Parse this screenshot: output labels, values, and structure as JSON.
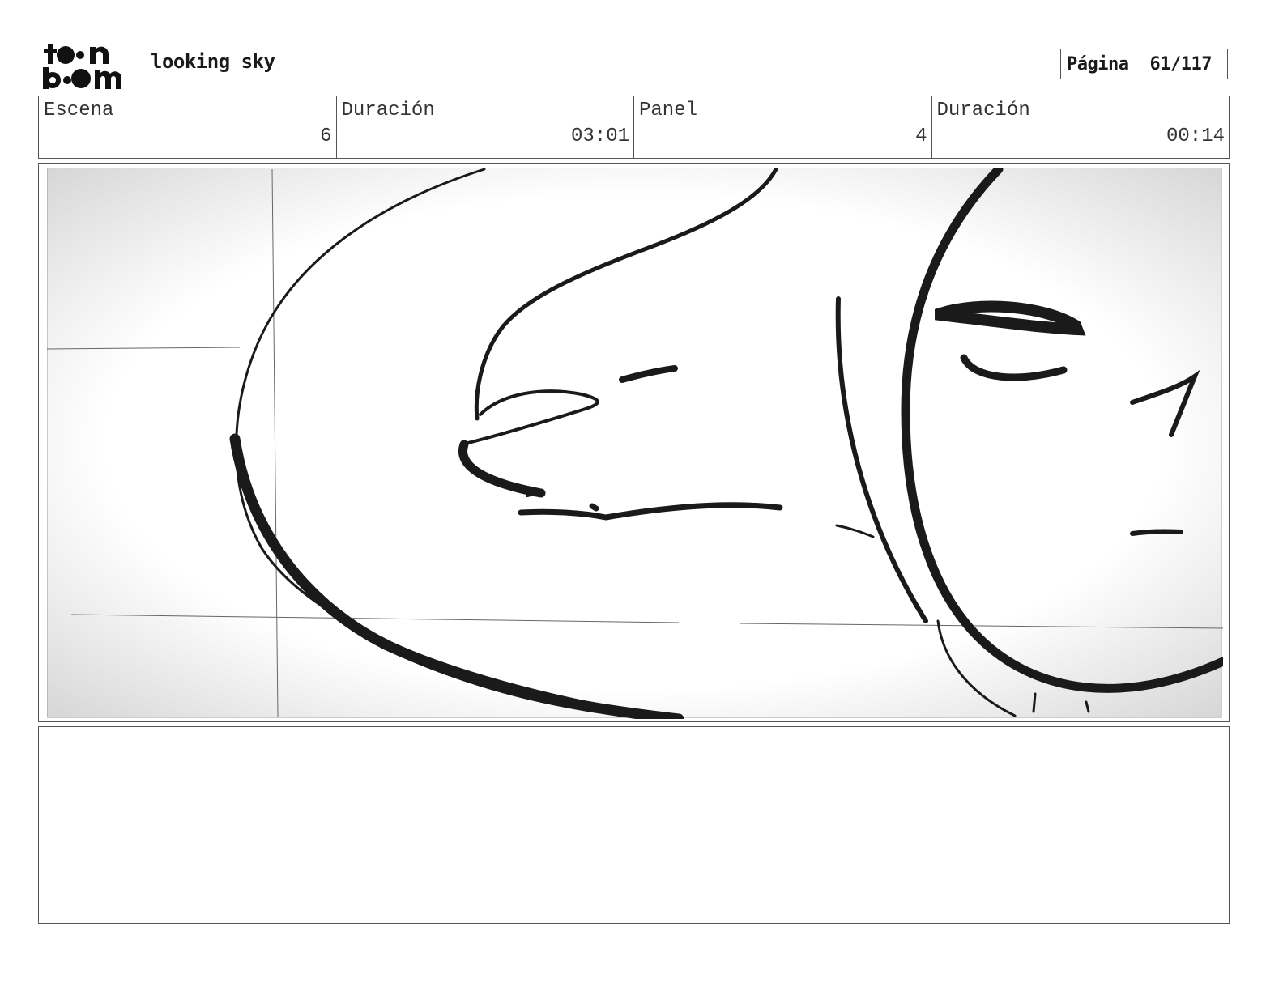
{
  "header": {
    "logo_text": "toon boom",
    "project_title": "looking sky",
    "page_label": "Página",
    "page_number": "61/117"
  },
  "info": [
    {
      "label": "Escena",
      "value": "6"
    },
    {
      "label": "Duración",
      "value": "03:01"
    },
    {
      "label": "Panel",
      "value": "4"
    },
    {
      "label": "Duración",
      "value": "00:14"
    }
  ],
  "panel": {
    "description": ""
  },
  "notes": {
    "text": ""
  }
}
